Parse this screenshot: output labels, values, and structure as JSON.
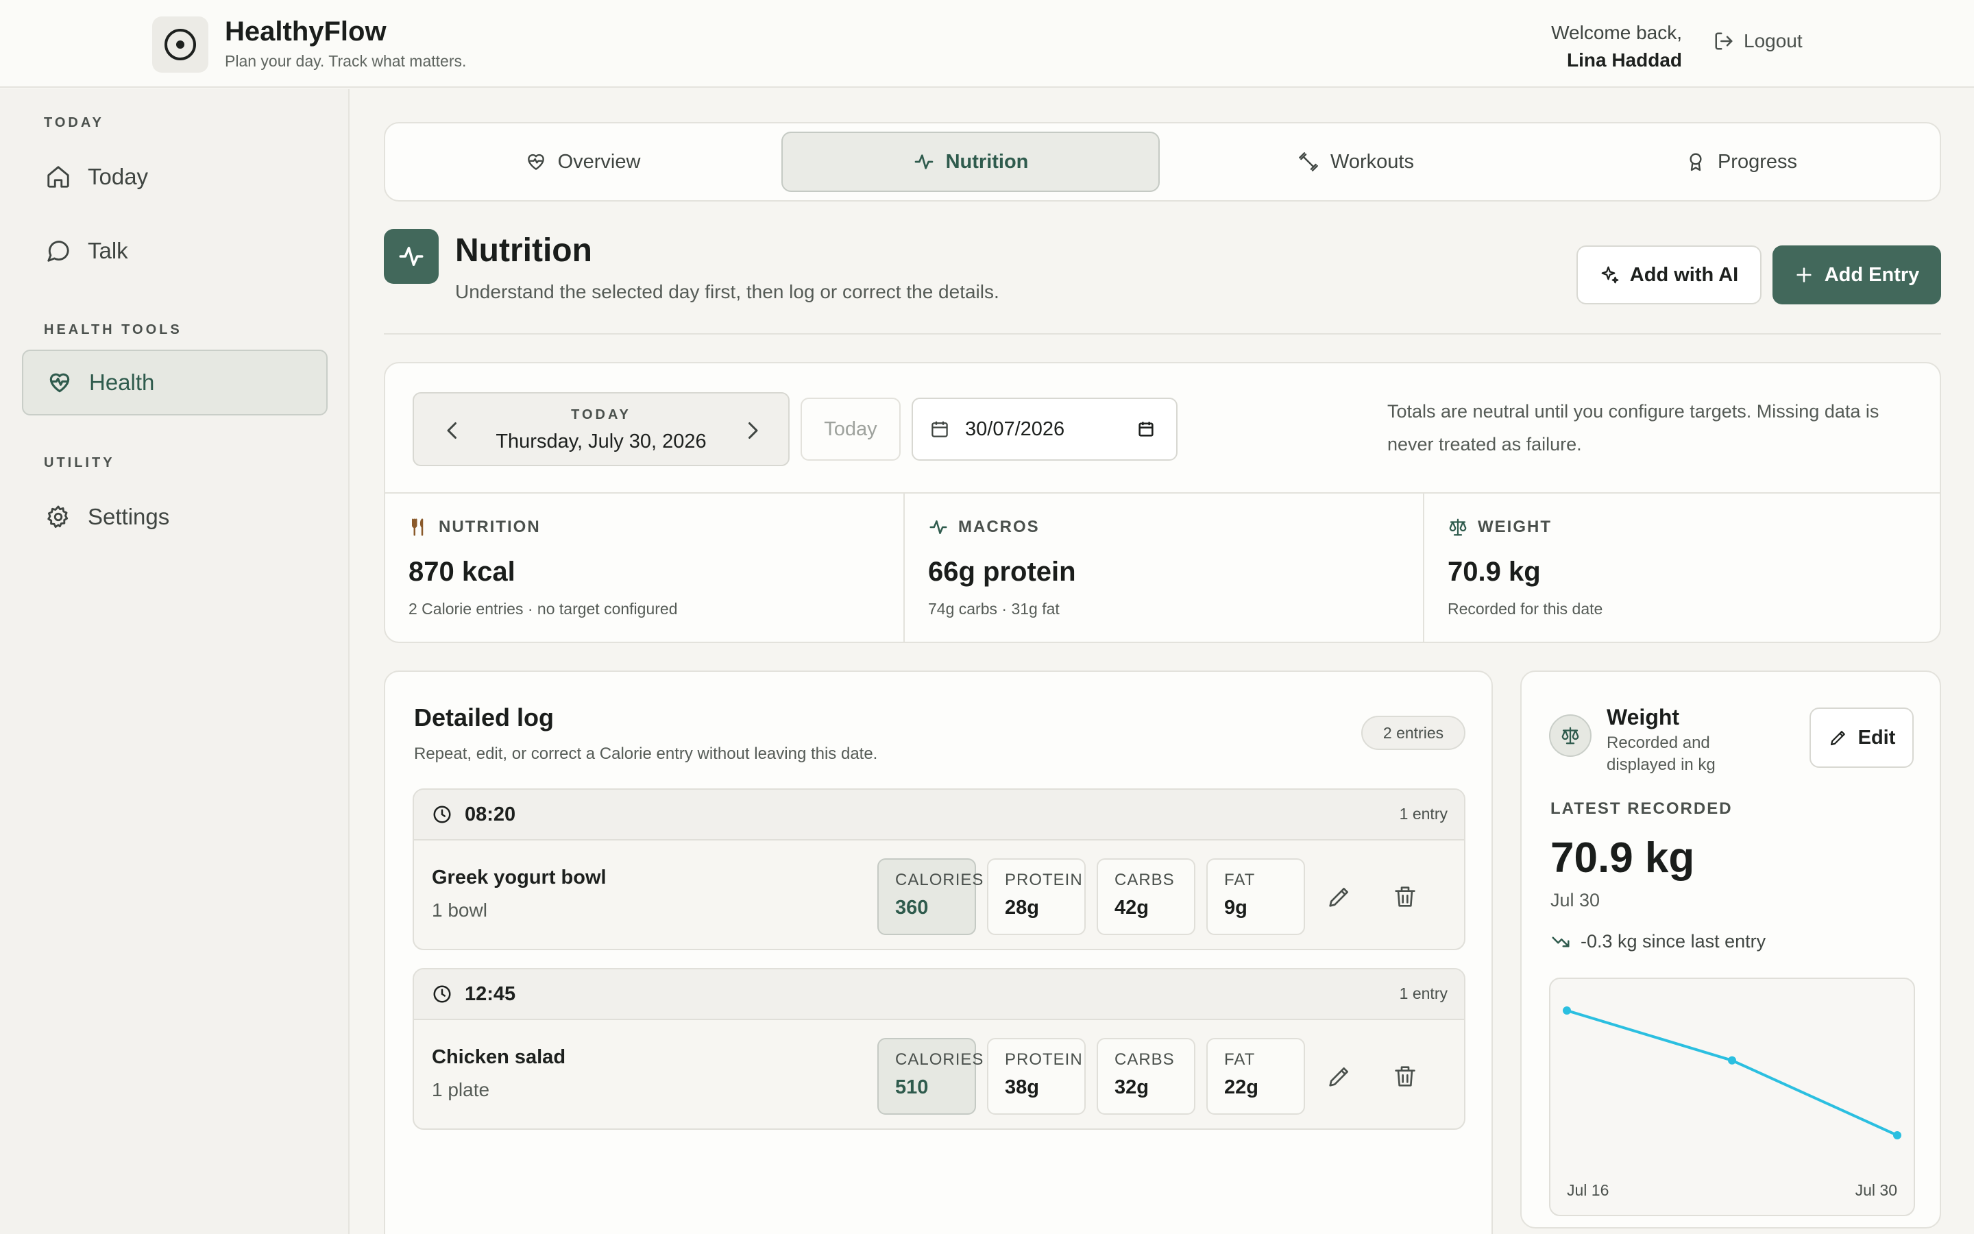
{
  "app": {
    "name": "HealthyFlow",
    "tagline": "Plan your day. Track what matters.",
    "welcome": "Welcome back,",
    "user_name": "Lina Haddad",
    "logout_label": "Logout"
  },
  "sidebar": {
    "sections": [
      {
        "label": "TODAY",
        "items": [
          {
            "label": "Today",
            "icon": "home-icon"
          },
          {
            "label": "Talk",
            "icon": "chat-icon"
          }
        ]
      },
      {
        "label": "HEALTH TOOLS",
        "items": [
          {
            "label": "Health",
            "icon": "heart-pulse-icon",
            "active": true
          }
        ]
      },
      {
        "label": "UTILITY",
        "items": [
          {
            "label": "Settings",
            "icon": "gear-icon"
          }
        ]
      }
    ]
  },
  "tabs": [
    {
      "label": "Overview",
      "icon": "heart-icon"
    },
    {
      "label": "Nutrition",
      "icon": "pulse-icon",
      "active": true
    },
    {
      "label": "Workouts",
      "icon": "dumbbell-icon"
    },
    {
      "label": "Progress",
      "icon": "award-icon"
    }
  ],
  "page": {
    "title": "Nutrition",
    "subtitle": "Understand the selected day first, then log or correct the details.",
    "add_ai_label": "Add with AI",
    "add_entry_label": "Add Entry"
  },
  "date_nav": {
    "label": "TODAY",
    "value": "Thursday, July 30, 2026",
    "today_button": "Today",
    "date_input": "30/07/2026",
    "note": "Totals are neutral until you configure targets. Missing data is never treated as failure."
  },
  "stats": [
    {
      "label": "NUTRITION",
      "icon": "utensils-icon",
      "value": "870 kcal",
      "sub": "2 Calorie entries · no target configured"
    },
    {
      "label": "MACROS",
      "icon": "pulse-icon",
      "value": "66g protein",
      "sub": "74g carbs · 31g fat"
    },
    {
      "label": "WEIGHT",
      "icon": "scale-icon",
      "value": "70.9 kg",
      "sub": "Recorded for this date"
    }
  ],
  "log": {
    "title": "Detailed log",
    "subtitle": "Repeat, edit, or correct a Calorie entry without leaving this date.",
    "badge": "2 entries",
    "groups": [
      {
        "time": "08:20",
        "count": "1 entry",
        "name": "Greek yogurt bowl",
        "qty": "1 bowl",
        "chips": [
          {
            "label": "CALORIES",
            "value": "360"
          },
          {
            "label": "PROTEIN",
            "value": "28g"
          },
          {
            "label": "CARBS",
            "value": "42g"
          },
          {
            "label": "FAT",
            "value": "9g"
          }
        ]
      },
      {
        "time": "12:45",
        "count": "1 entry",
        "name": "Chicken salad",
        "qty": "1 plate",
        "chips": [
          {
            "label": "CALORIES",
            "value": "510"
          },
          {
            "label": "PROTEIN",
            "value": "38g"
          },
          {
            "label": "CARBS",
            "value": "32g"
          },
          {
            "label": "FAT",
            "value": "22g"
          }
        ]
      }
    ]
  },
  "weight": {
    "title": "Weight",
    "subtitle": "Recorded and displayed in kg",
    "edit_label": "Edit",
    "latest_label": "LATEST RECORDED",
    "value": "70.9 kg",
    "date": "Jul 30",
    "delta": "-0.3 kg since last entry",
    "chart_data": {
      "type": "line",
      "x": [
        "Jul 16",
        "Jul 23",
        "Jul 30"
      ],
      "y": [
        71.4,
        71.2,
        70.9
      ],
      "x_tick_labels": [
        "Jul 16",
        "Jul 30"
      ],
      "color": "#2bbfe0"
    }
  },
  "colors": {
    "accent": "#42685b",
    "line": "#2bbfe0",
    "background": "#f6f5f1"
  }
}
